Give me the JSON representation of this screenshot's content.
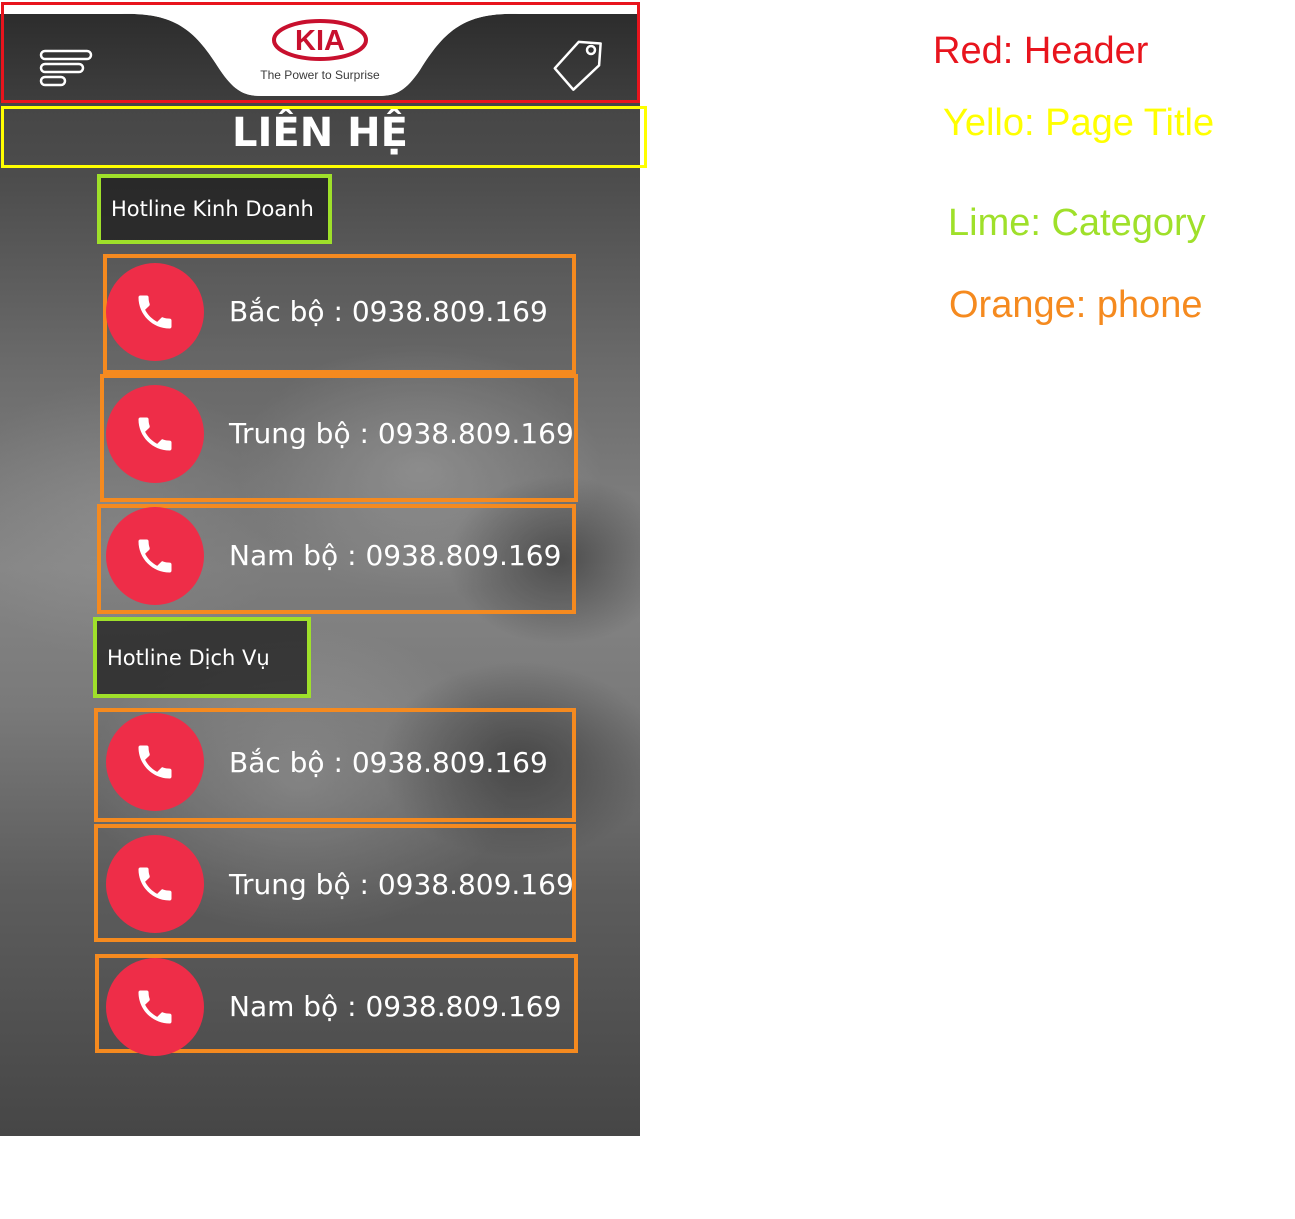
{
  "header": {
    "brand": "KIA",
    "tagline": "The Power to Surprise",
    "menu_icon": "menu-icon",
    "tag_icon": "tag-icon"
  },
  "page_title": "LIÊN HỆ",
  "categories": [
    {
      "label": "Hotline Kinh Doanh"
    },
    {
      "label": "Hotline Dịch Vụ"
    }
  ],
  "phones": [
    {
      "region": "Bắc bộ :",
      "number": "0938.809.169"
    },
    {
      "region": "Trung bộ :",
      "number": "0938.809.169"
    },
    {
      "region": "Nam bộ :",
      "number": "0938.809.169"
    },
    {
      "region": "Bắc bộ :",
      "number": "0938.809.169"
    },
    {
      "region": "Trung bộ :",
      "number": "0938.809.169"
    },
    {
      "region": "Nam bộ :",
      "number": "0938.809.169"
    }
  ],
  "legend": [
    {
      "text": "Red: Header",
      "color": "#e8141d"
    },
    {
      "text": "Yello: Page Title",
      "color": "#ffff00"
    },
    {
      "text": "Lime: Category",
      "color": "#9fe02a"
    },
    {
      "text": "Orange: phone",
      "color": "#f58a1f"
    }
  ],
  "colors": {
    "call_button": "#ee2d48",
    "kia_red": "#c8102e"
  }
}
